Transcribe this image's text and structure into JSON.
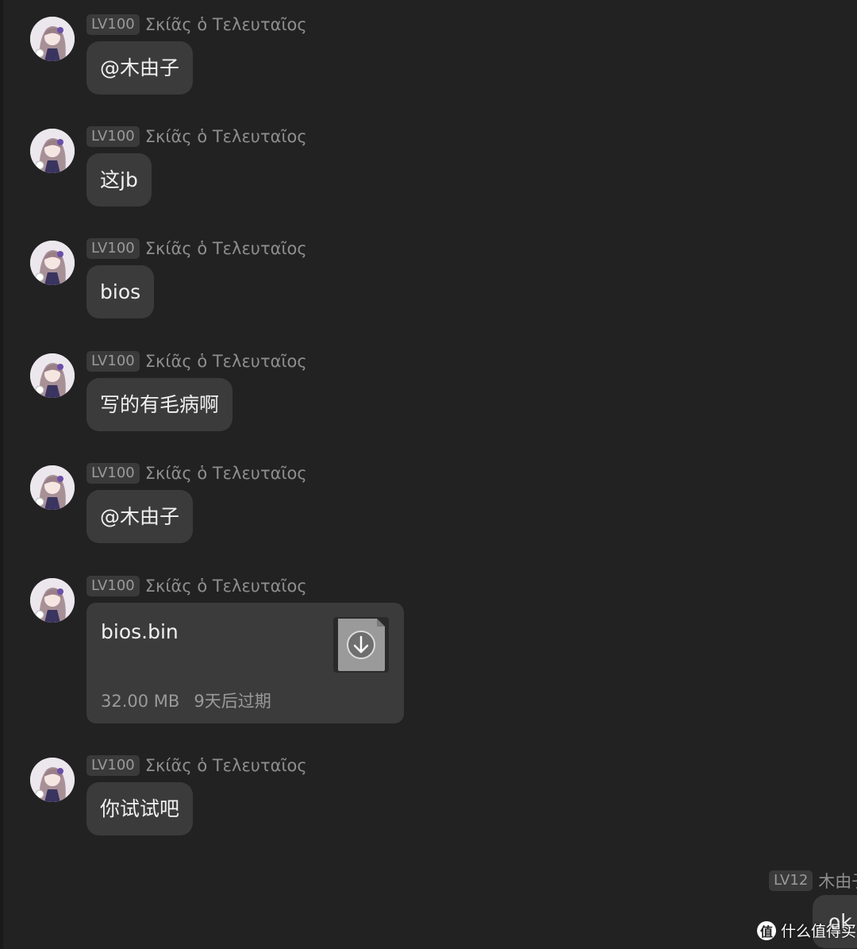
{
  "messages": [
    {
      "level": "LV100",
      "sender": "Σκίᾶς ὁ Τελευταῖος",
      "text": "@木由子"
    },
    {
      "level": "LV100",
      "sender": "Σκίᾶς ὁ Τελευταῖος",
      "text": "这jb"
    },
    {
      "level": "LV100",
      "sender": "Σκίᾶς ὁ Τελευταῖος",
      "text": "bios"
    },
    {
      "level": "LV100",
      "sender": "Σκίᾶς ὁ Τελευταῖος",
      "text": "写的有毛病啊"
    },
    {
      "level": "LV100",
      "sender": "Σκίᾶς ὁ Τελευταῖος",
      "text": "@木由子"
    },
    {
      "level": "LV100",
      "sender": "Σκίᾶς ὁ Τελευταῖος",
      "file": {
        "name": "bios.bin",
        "size": "32.00 MB",
        "expiry": "9天后过期",
        "icon": "download-icon"
      }
    },
    {
      "level": "LV100",
      "sender": "Σκίᾶς ὁ Τελευταῖος",
      "text": "你试试吧"
    }
  ],
  "self_message": {
    "level": "LV12",
    "sender": "木由子",
    "text": "ok"
  },
  "watermark": {
    "logo": "值",
    "text": "什么值得买"
  },
  "colors": {
    "background": "#222222",
    "bubble": "#3b3b3b",
    "text": "#f0f0f0",
    "muted": "#8e8e8e"
  }
}
